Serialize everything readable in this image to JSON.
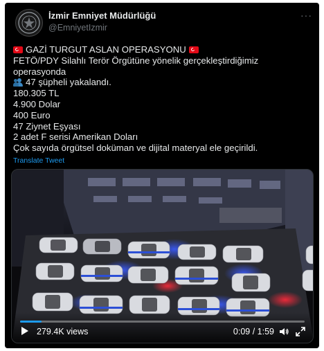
{
  "account": {
    "name": "İzmir Emniyet Müdürlüğü",
    "handle": "@EmniyetIzmir",
    "more_label": "···"
  },
  "tweet": {
    "lines": [
      "GAZİ TURGUT ASLAN OPERASYONU",
      "FETÖ/PDY Silahlı Terör Örgütüne yönelik gerçekleştirdiğimiz",
      "operasyonda",
      "47 şüpheli yakalandı.",
      "180.305 TL",
      "4.900 Dolar",
      "400 Euro",
      "47 Ziynet Eşyası",
      "2 adet F serisi Amerikan Doları",
      "Çok sayıda örgütsel doküman ve dijital materyal ele geçirildi."
    ],
    "translate_label": "Translate Tweet"
  },
  "video": {
    "views": "279.4K views",
    "time": "0:09 / 1:59",
    "progress": 0.076
  },
  "colors": {
    "background": "#000000",
    "text": "#e7e9ea",
    "secondary": "#71767b",
    "link": "#1d9bf0",
    "flag_red": "#e30a17"
  },
  "icons": {
    "flag": "turkey-flag-icon",
    "people": "busts-in-silhouette-icon",
    "play": "play-icon",
    "volume": "speaker-icon",
    "fullscreen": "expand-icon",
    "more": "more-options-icon"
  }
}
